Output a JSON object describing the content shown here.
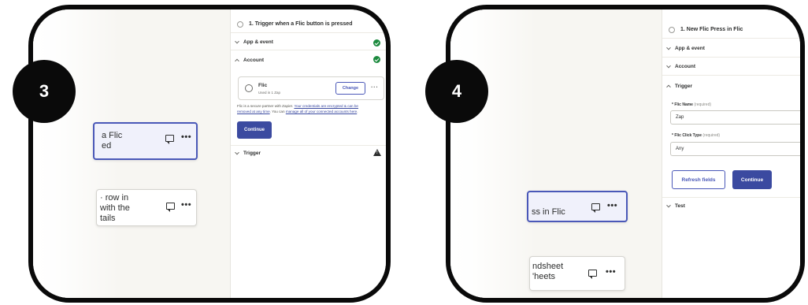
{
  "steps": [
    {
      "number": "3",
      "canvas_cards": [
        {
          "text": "a Flic\ned"
        },
        {
          "text": "· row in\nwith the\ntails"
        }
      ],
      "panel": {
        "title": "1. Trigger when a Flic button is pressed",
        "sections": {
          "app_event": "App & event",
          "account": "Account",
          "trigger": "Trigger"
        },
        "account_card": {
          "name": "Flic",
          "used_in": "Used in 1 Zap",
          "change_label": "Change"
        },
        "note": {
          "line1_plain": "Flic is a secure partner with Zapier. ",
          "line1_link": "Your credentials are encrypted & can be",
          "line2_link": "removed at any time",
          "line2_plain": ". You can ",
          "line2_link2": "manage all of your connected accounts here",
          "line2_end": "."
        },
        "continue_label": "Continue"
      }
    },
    {
      "number": "4",
      "canvas_cards": [
        {
          "text": "ss in Flic"
        },
        {
          "text": "ndsheet\n'heets"
        }
      ],
      "panel": {
        "title": "1. New Flic Press in Flic",
        "sections": {
          "app_event": "App & event",
          "account": "Account",
          "trigger": "Trigger",
          "test": "Test"
        },
        "fields": [
          {
            "label": "* Flic Name",
            "hint": "(required)",
            "value": "Zap"
          },
          {
            "label": "* Flic Click Type",
            "hint": "(required)",
            "value": "Any"
          }
        ],
        "refresh_label": "Refresh fields",
        "continue_label": "Continue"
      }
    }
  ],
  "colors": {
    "accent": "#3b4aa0",
    "success": "#1c8a3e",
    "frame": "#0a0a0a"
  }
}
